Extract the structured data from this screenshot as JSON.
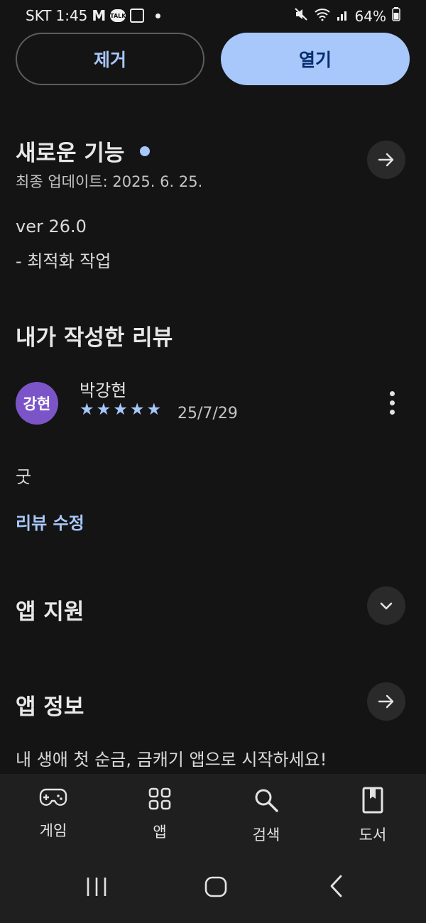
{
  "status_bar": {
    "carrier": "SKT",
    "time": "1:45",
    "notif_icons": [
      "gmail-icon",
      "kakaotalk-icon",
      "gallery-icon"
    ],
    "kakao_label": "TALK",
    "battery": "64%"
  },
  "actions": {
    "remove_label": "제거",
    "open_label": "열기"
  },
  "whats_new": {
    "title": "새로운 기능",
    "last_updated": "최종 업데이트: 2025. 6. 25.",
    "version": "ver 26.0",
    "notes": "- 최적화 작업"
  },
  "my_review": {
    "title": "내가 작성한 리뷰",
    "avatar_text": "강현",
    "author": "박강현",
    "rating": 5,
    "rating_max": 5,
    "date": "25/7/29",
    "text": "굿",
    "edit_label": "리뷰 수정"
  },
  "app_support": {
    "title": "앱 지원"
  },
  "app_info": {
    "title": "앱 정보",
    "description": "내 생애 첫 순금, 금캐기 앱으로 시작하세요!"
  },
  "bottom_nav": [
    {
      "label": "게임",
      "icon": "gamepad-icon"
    },
    {
      "label": "앱",
      "icon": "apps-grid-icon"
    },
    {
      "label": "검색",
      "icon": "search-icon"
    },
    {
      "label": "도서",
      "icon": "book-icon"
    }
  ],
  "colors": {
    "background": "#141414",
    "accent": "#a8c7fa",
    "avatar": "#7b55c8",
    "nav_background": "#1f1f1f"
  }
}
